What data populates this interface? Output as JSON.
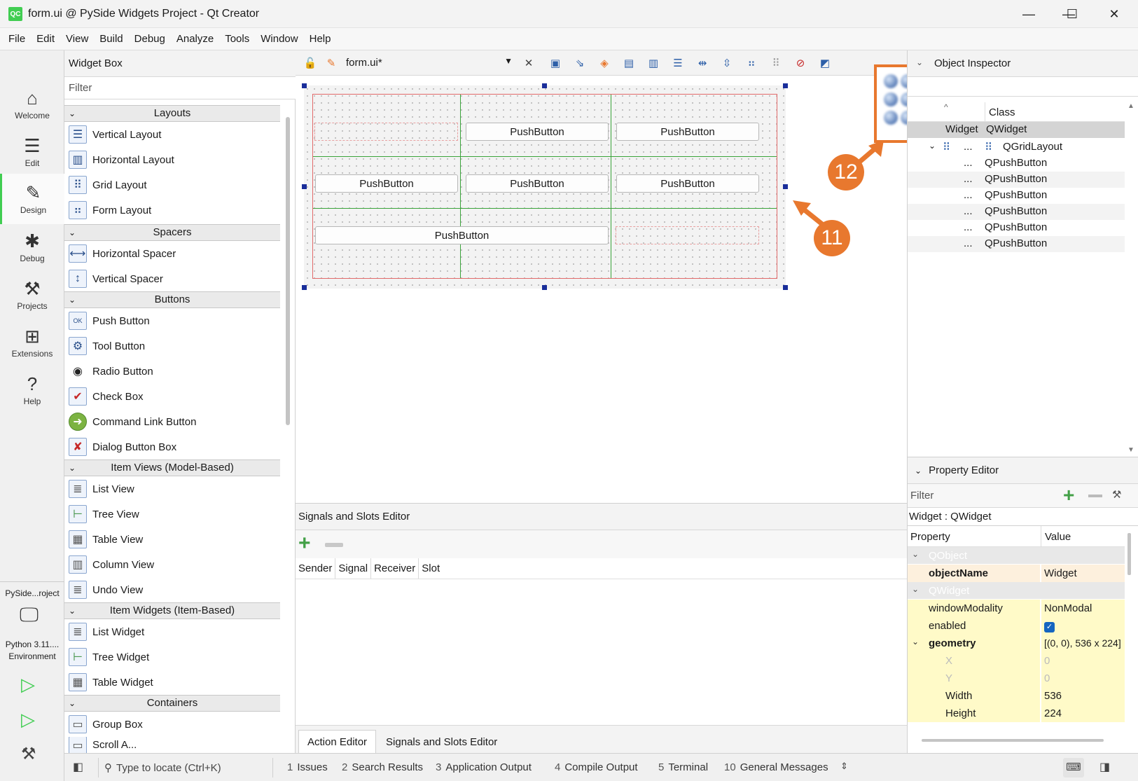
{
  "window": {
    "app_icon": "QC",
    "title": "form.ui @ PySide Widgets Project - Qt Creator",
    "minimize": "—",
    "maximize": "☐",
    "close": "✕"
  },
  "menu": [
    "File",
    "Edit",
    "View",
    "Build",
    "Debug",
    "Analyze",
    "Tools",
    "Window",
    "Help"
  ],
  "modes": [
    {
      "label": "Welcome",
      "icon": "home-icon"
    },
    {
      "label": "Edit",
      "icon": "edit-icon"
    },
    {
      "label": "Design",
      "icon": "design-icon"
    },
    {
      "label": "Debug",
      "icon": "debug-icon"
    },
    {
      "label": "Projects",
      "icon": "wrench-icon"
    },
    {
      "label": "Extensions",
      "icon": "extensions-icon"
    },
    {
      "label": "Help",
      "icon": "help-icon"
    }
  ],
  "kit": {
    "project": "PySide...roject",
    "env_line1": "Python 3.11....",
    "env_line2": "Environment"
  },
  "widget_box": {
    "title": "Widget Box",
    "filter_placeholder": "Filter",
    "categories": {
      "layouts": "Layouts",
      "spacers": "Spacers",
      "buttons": "Buttons",
      "item_views": "Item Views (Model-Based)",
      "item_widgets": "Item Widgets (Item-Based)",
      "containers": "Containers"
    },
    "items": {
      "vertical_layout": "Vertical Layout",
      "horizontal_layout": "Horizontal Layout",
      "grid_layout": "Grid Layout",
      "form_layout": "Form Layout",
      "horizontal_spacer": "Horizontal Spacer",
      "vertical_spacer": "Vertical Spacer",
      "push_button": "Push Button",
      "tool_button": "Tool Button",
      "radio_button": "Radio Button",
      "check_box": "Check Box",
      "command_link_button": "Command Link Button",
      "dialog_button_box": "Dialog Button Box",
      "list_view": "List View",
      "tree_view": "Tree View",
      "table_view": "Table View",
      "column_view": "Column View",
      "undo_view": "Undo View",
      "list_widget": "List Widget",
      "tree_widget": "Tree Widget",
      "table_widget": "Table Widget",
      "group_box": "Group Box",
      "scroll_area": "Scroll A..."
    }
  },
  "editor": {
    "file_name": "form.ui*",
    "push_button_text": "PushButton"
  },
  "callouts": {
    "c11": "11",
    "c12": "12"
  },
  "signals_slots": {
    "title": "Signals and Slots Editor",
    "columns": [
      "Sender",
      "Signal",
      "Receiver",
      "Slot"
    ],
    "tabs": [
      "Action Editor",
      "Signals and Slots Editor"
    ]
  },
  "object_inspector": {
    "title": "Object Inspector",
    "col_class": "Class",
    "rows": [
      {
        "object": "Widget",
        "class": "QWidget"
      },
      {
        "object": "...",
        "class": "QGridLayout"
      },
      {
        "object": "...",
        "class": "QPushButton"
      },
      {
        "object": "...",
        "class": "QPushButton"
      },
      {
        "object": "...",
        "class": "QPushButton"
      },
      {
        "object": "...",
        "class": "QPushButton"
      },
      {
        "object": "...",
        "class": "QPushButton"
      },
      {
        "object": "...",
        "class": "QPushButton"
      }
    ]
  },
  "property_editor": {
    "title": "Property Editor",
    "filter_placeholder": "Filter",
    "class_label": "Widget : QWidget",
    "col_property": "Property",
    "col_value": "Value",
    "rows": {
      "qobject": "QObject",
      "object_name": "objectName",
      "object_name_value": "Widget",
      "qwidget": "QWidget",
      "window_modality": "windowModality",
      "window_modality_value": "NonModal",
      "enabled": "enabled",
      "geometry": "geometry",
      "geometry_value": "[(0, 0), 536 x 224]",
      "x": "X",
      "x_value": "0",
      "y": "Y",
      "y_value": "0",
      "width": "Width",
      "width_value": "536",
      "height": "Height",
      "height_value": "224"
    }
  },
  "statusbar": {
    "locate_placeholder": "Type to locate (Ctrl+K)",
    "panes": [
      {
        "num": "1",
        "label": "Issues"
      },
      {
        "num": "2",
        "label": "Search Results"
      },
      {
        "num": "3",
        "label": "Application Output"
      },
      {
        "num": "4",
        "label": "Compile Output"
      },
      {
        "num": "5",
        "label": "Terminal"
      },
      {
        "num": "10",
        "label": "General Messages"
      }
    ]
  },
  "colors": {
    "accent": "#41cd52",
    "callout": "#e8782e",
    "handle": "#1a2e9a",
    "layout_red": "#e26a6a",
    "grid_green": "#3aa33a"
  }
}
